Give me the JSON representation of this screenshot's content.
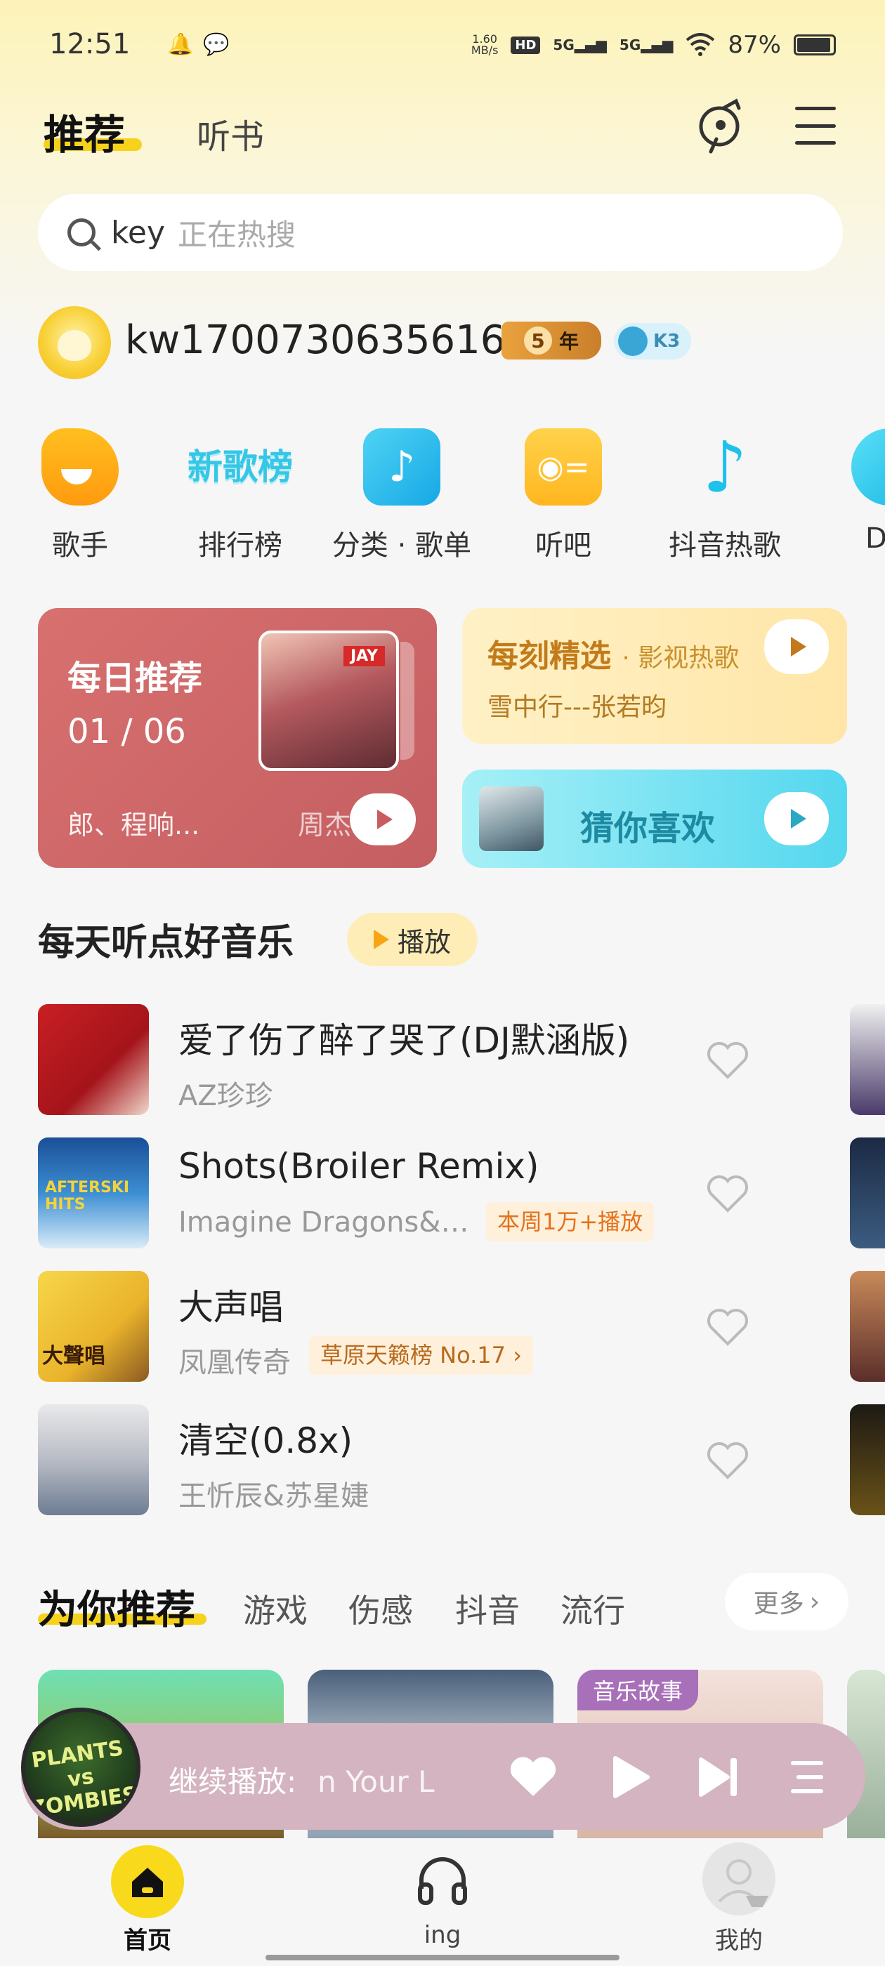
{
  "status_bar": {
    "time": "12:51",
    "net_speed_value": "1.60",
    "net_speed_unit": "MB/s",
    "hd": "HD",
    "sim1": "5G",
    "sim2": "5G",
    "battery": "87%"
  },
  "header": {
    "tab_active": "推荐",
    "tab_other": "听书"
  },
  "search": {
    "keyword": "key",
    "hint": "正在热搜"
  },
  "user": {
    "name": "kw1700730635616",
    "vip_years": "5",
    "vip_unit": "年",
    "level": "K3"
  },
  "quick_entries": [
    {
      "label": "歌手",
      "icon": "singer-icon"
    },
    {
      "label": "排行榜",
      "icon_text": "新歌榜"
    },
    {
      "label": "分类 · 歌单",
      "icon": "music-note-icon"
    },
    {
      "label": "听吧",
      "icon": "radio-icon"
    },
    {
      "label": "抖音热歌",
      "icon": "douyin-note-icon"
    },
    {
      "label": "D",
      "icon": "dj-icon"
    }
  ],
  "cards": {
    "daily": {
      "title": "每日推荐",
      "date": "01 / 06",
      "cover_tag": "JAY",
      "artists": "郎、程响...",
      "zhou": "周杰"
    },
    "moment": {
      "title": "每刻精选",
      "tag": "· 影视热歌",
      "subtitle": "雪中行---张若昀"
    },
    "guess": {
      "title": "猜你喜欢"
    }
  },
  "daily_music": {
    "title": "每天听点好音乐",
    "play_label": "播放",
    "songs": [
      {
        "title": "爱了伤了醉了哭了(DJ默涵版)",
        "artist": "AZ珍珍",
        "tag": ""
      },
      {
        "title": "Shots(Broiler Remix)",
        "artist": "Imagine Dragons&…",
        "tag": "本周1万+播放"
      },
      {
        "title": "大声唱",
        "artist": "凤凰传奇",
        "tag": "草原天籁榜 No.17 ›"
      },
      {
        "title": "清空(0.8x)",
        "artist": "王忻辰&苏星婕",
        "tag": ""
      }
    ],
    "cover_texts": [
      "AFTERSKI HITS",
      "大聲唱"
    ]
  },
  "for_you": {
    "title": "为你推荐",
    "tabs": [
      "游戏",
      "伤感",
      "抖音",
      "流行"
    ],
    "more": "更多",
    "story_tag": "音乐故事"
  },
  "mini_player": {
    "prefix": "继续播放:",
    "song": "n Your L",
    "cover_text": "PLANTS vs ZOMBIES"
  },
  "bottom_nav": {
    "home": "首页",
    "listening": "ing",
    "me": "我的"
  },
  "colors": {
    "accent_yellow": "#f7d21c",
    "daily_card": "#cd6567",
    "moment_card": "#ffebb6",
    "guess_card": "#6fdff1",
    "mini_player": "#d4b4c0",
    "tag_orange": "#e4721c"
  }
}
